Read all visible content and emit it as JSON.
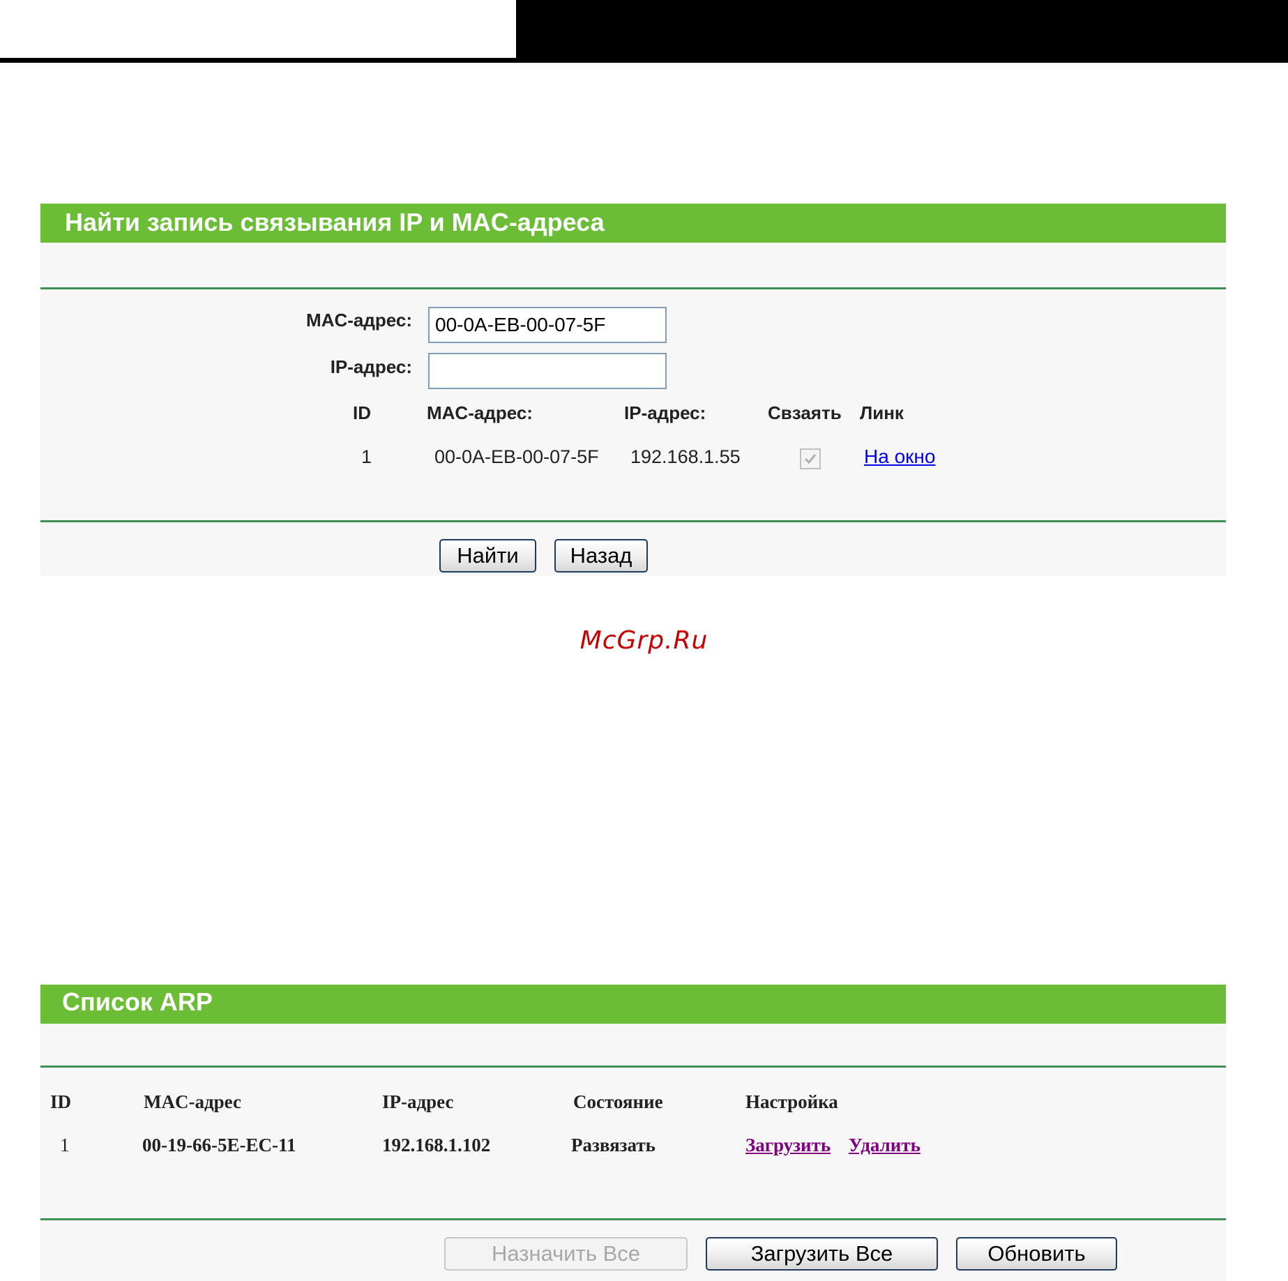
{
  "search_panel": {
    "title": "Найти запись связывания IP и MAC-адреса",
    "mac_label": "MAC-адрес:",
    "mac_value": "00-0A-EB-00-07-5F",
    "ip_label": "IP-адрес:",
    "ip_value": "",
    "columns": [
      "ID",
      "MAC-адрес:",
      "IP-адрес:",
      "Свзаять",
      "Линк"
    ],
    "rows": [
      {
        "id": "1",
        "mac": "00-0A-EB-00-07-5F",
        "ip": "192.168.1.55",
        "bind_checked": true,
        "link": "На окно"
      }
    ],
    "find_button": "Найти",
    "back_button": "Назад"
  },
  "watermark": "McGrp.Ru",
  "arp_panel": {
    "title": "Список ARP",
    "columns": [
      "ID",
      "MAC-адрес",
      "IP-адрес",
      "Состояние",
      "Настройка"
    ],
    "rows": [
      {
        "id": "1",
        "mac": "00-19-66-5E-EC-11",
        "ip": "192.168.1.102",
        "state": "Развязать",
        "load_link": "Загрузить",
        "delete_link": "Удалить"
      }
    ],
    "assign_all_button": "Назначить Все",
    "load_all_button": "Загрузить Все",
    "refresh_button": "Обновить"
  },
  "colors": {
    "header_green": "#6abd34",
    "divider_green": "#3d8f52",
    "panel_bg": "#f7f7f7",
    "link_blue": "#0000ee",
    "link_visited": "#800080",
    "watermark_red": "#c80000"
  }
}
